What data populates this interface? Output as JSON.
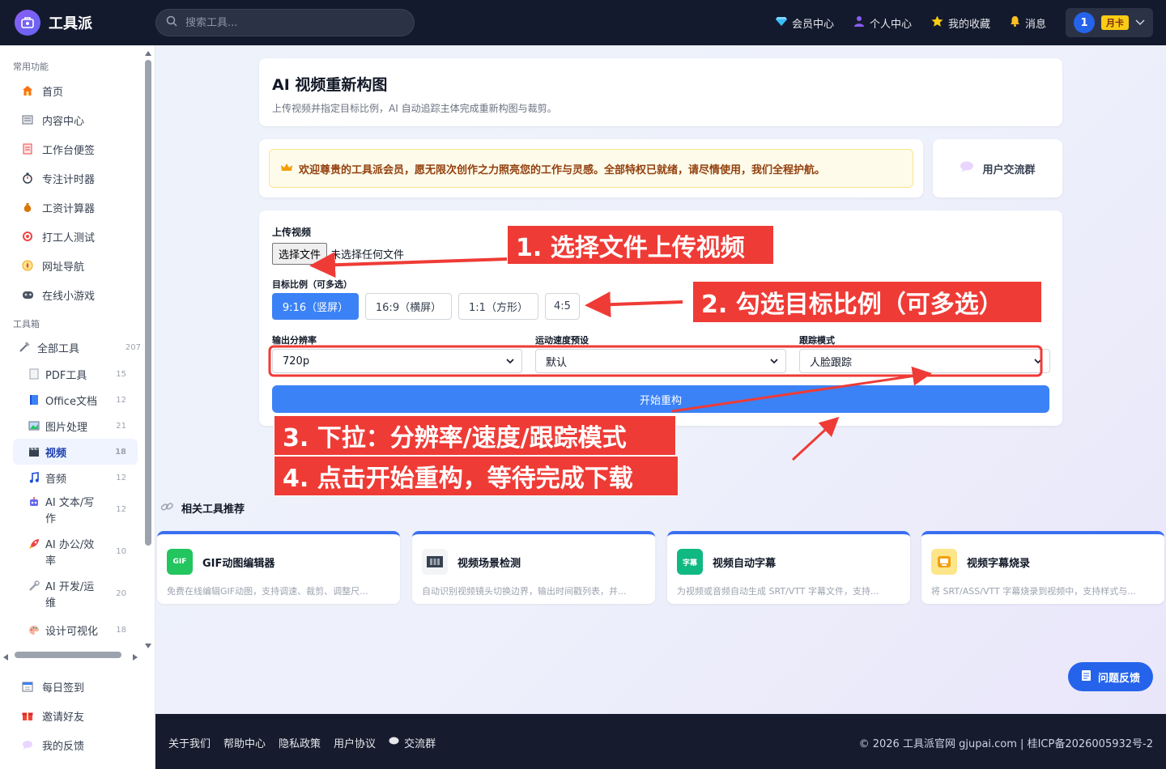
{
  "app": {
    "name": "工具派"
  },
  "search": {
    "placeholder": "搜索工具..."
  },
  "nav": {
    "member": "会员中心",
    "personal": "个人中心",
    "favorites": "我的收藏",
    "messages": "消息",
    "user_number": "1",
    "plan_badge": "月卡"
  },
  "sidebar": {
    "section_common": "常用功能",
    "common_items": [
      {
        "label": "首页",
        "icon": "home-icon"
      },
      {
        "label": "内容中心",
        "icon": "newspaper-icon"
      },
      {
        "label": "工作台便签",
        "icon": "memo-icon"
      },
      {
        "label": "专注计时器",
        "icon": "stopwatch-icon"
      },
      {
        "label": "工资计算器",
        "icon": "money-bag-icon"
      },
      {
        "label": "打工人测试",
        "icon": "target-icon"
      },
      {
        "label": "网址导航",
        "icon": "compass-icon"
      },
      {
        "label": "在线小游戏",
        "icon": "gamepad-icon"
      }
    ],
    "section_toolbox": "工具箱",
    "all_tools": {
      "label": "全部工具",
      "count": "207"
    },
    "categories": [
      {
        "label": "PDF工具",
        "count": "15"
      },
      {
        "label": "Office文档",
        "count": "12"
      },
      {
        "label": "图片处理",
        "count": "21"
      },
      {
        "label": "视频",
        "count": "18"
      },
      {
        "label": "音频",
        "count": "12"
      },
      {
        "label_line1": "AI 文本/写",
        "label_line2": "作",
        "count": "12"
      },
      {
        "label_line1": "AI 办公/效",
        "label_line2": "率",
        "count": "10"
      },
      {
        "label_line1": "AI 开发/运",
        "label_line2": "维",
        "count": "20"
      },
      {
        "label": "设计可视化",
        "count": "18"
      }
    ],
    "bottom_items": [
      {
        "label": "每日签到"
      },
      {
        "label": "邀请好友"
      },
      {
        "label": "我的反馈"
      }
    ]
  },
  "header_panel": {
    "title": "AI 视频重新构图",
    "subtitle": "上传视频并指定目标比例，AI 自动追踪主体完成重新构图与裁剪。"
  },
  "welcome": {
    "text": "欢迎尊贵的工具派会员，愿无限次创作之力照亮您的工作与灵感。全部特权已就绪，请尽情使用，我们全程护航。"
  },
  "group": {
    "label": "用户交流群"
  },
  "form": {
    "upload_label": "上传视频",
    "file_button": "选择文件",
    "file_status": "未选择任何文件",
    "ratio_label": "目标比例（可多选）",
    "ratios": [
      "9:16（竖屏）",
      "16:9（横屏）",
      "1:1（方形）",
      "4:5"
    ],
    "selected_ratio_index": 0,
    "resolution_label": "输出分辨率",
    "resolution_value": "720p",
    "speed_label": "运动速度预设",
    "speed_value": "默认",
    "tracking_label": "跟踪模式",
    "tracking_value": "人脸跟踪",
    "start_button": "开始重构"
  },
  "annotations": {
    "step1": "1. 选择文件上传视频",
    "step2": "2. 勾选目标比例（可多选）",
    "step3": "3. 下拉：分辨率/速度/跟踪模式",
    "step4": "4. 点击开始重构，等待完成下载",
    "color": "#ef3b36"
  },
  "related": {
    "title": "相关工具推荐",
    "items": [
      {
        "icon_text": "GIF",
        "title": "GIF动图编辑器",
        "desc": "免费在线编辑GIF动图，支持调速、裁剪、调整尺...",
        "color": "#22c55e"
      },
      {
        "icon_text": "",
        "title": "视频场景检测",
        "desc": "自动识别视频镜头切换边界，输出时间戳列表，并...",
        "color": "#374151"
      },
      {
        "icon_text": "字幕",
        "title": "视频自动字幕",
        "desc": "为视频或音频自动生成 SRT/VTT 字幕文件，支持...",
        "color": "#10b981"
      },
      {
        "icon_text": "",
        "title": "视频字幕烧录",
        "desc": "将 SRT/ASS/VTT 字幕烧录到视频中，支持样式与...",
        "color": "#f59e0b"
      }
    ]
  },
  "feedback": {
    "label": "问题反馈"
  },
  "footer": {
    "links": [
      "关于我们",
      "帮助中心",
      "隐私政策",
      "用户协议",
      "交流群"
    ],
    "copyright": "© 2026 工具派官网 gjupai.com | 桂ICP备2026005932号-2"
  },
  "colors": {
    "accent": "#3b82f6",
    "topbar": "#141a2d",
    "footer": "#161c2e"
  }
}
